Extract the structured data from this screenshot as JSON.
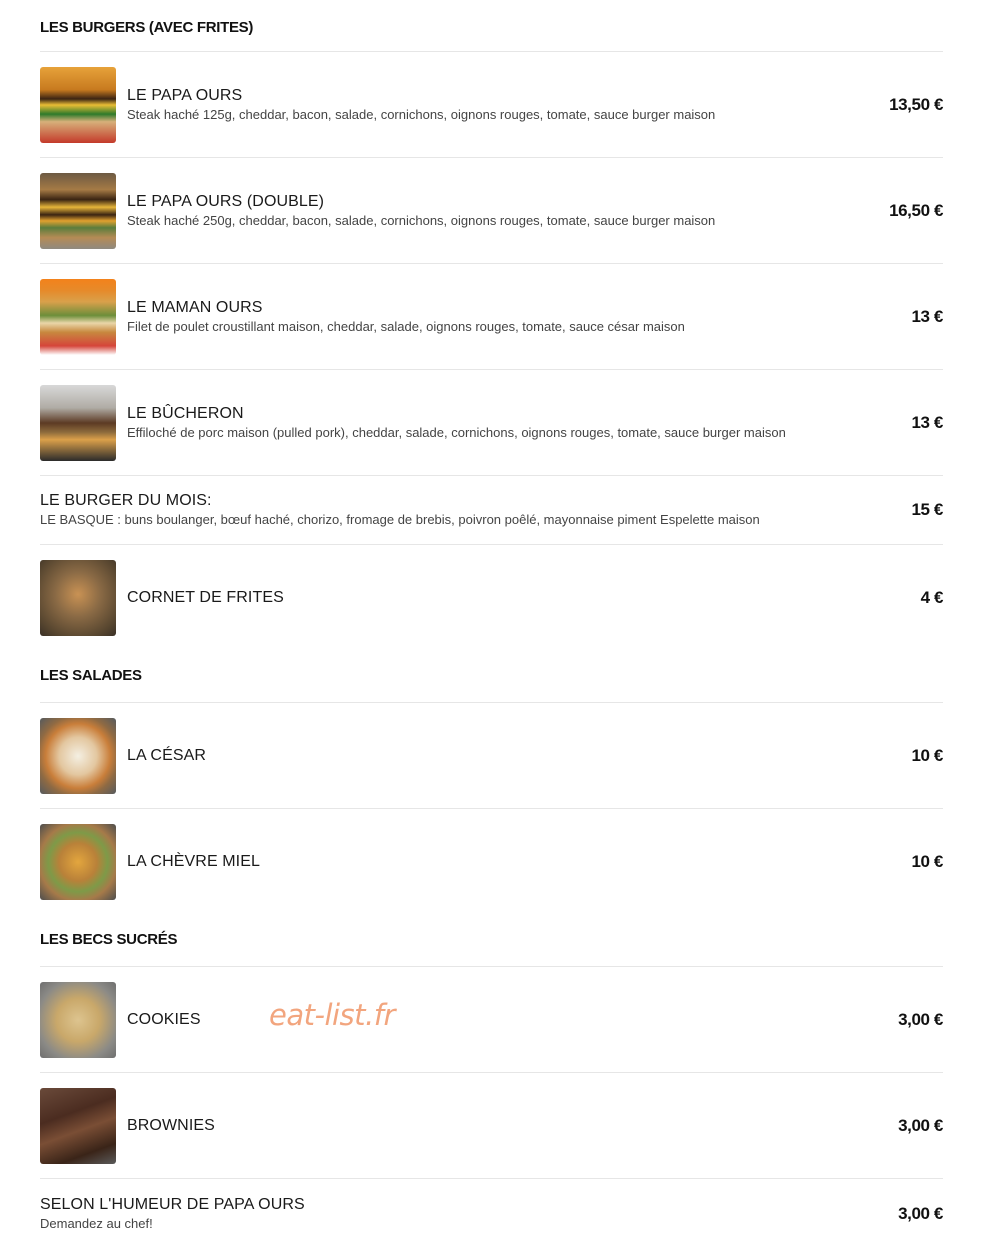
{
  "sections": {
    "burgers": {
      "title": "LES BURGERS (AVEC FRITES)",
      "items": [
        {
          "name": "LE PAPA OURS",
          "desc": "Steak haché 125g, cheddar, bacon, salade, cornichons, oignons rouges, tomate, sauce burger maison",
          "price": "13,50 €"
        },
        {
          "name": "LE PAPA OURS (DOUBLE)",
          "desc": "Steak haché 250g, cheddar, bacon, salade, cornichons, oignons rouges, tomate, sauce burger maison",
          "price": "16,50 €"
        },
        {
          "name": "LE MAMAN OURS",
          "desc": "Filet de poulet croustillant maison, cheddar, salade, oignons rouges, tomate, sauce césar maison",
          "price": "13 €"
        },
        {
          "name": "LE BÛCHERON",
          "desc": "Effiloché de porc maison (pulled pork), cheddar, salade, cornichons, oignons rouges, tomate, sauce burger maison",
          "price": "13 €"
        },
        {
          "name": "LE BURGER DU MOIS:",
          "desc": "LE BASQUE : buns boulanger, bœuf haché, chorizo, fromage de brebis, poivron poêlé, mayonnaise piment Espelette maison",
          "price": "15 €"
        },
        {
          "name": "CORNET DE FRITES",
          "desc": "",
          "price": "4 €"
        }
      ]
    },
    "salades": {
      "title": "LES SALADES",
      "items": [
        {
          "name": "LA CÉSAR",
          "price": "10 €"
        },
        {
          "name": "LA CHÈVRE MIEL",
          "price": "10 €"
        }
      ]
    },
    "sucres": {
      "title": "LES BECS SUCRÉS",
      "items": [
        {
          "name": "COOKIES",
          "price": "3,00 €"
        },
        {
          "name": "BROWNIES",
          "price": "3,00 €"
        },
        {
          "name": "SELON L'HUMEUR DE PAPA OURS",
          "desc": "Demandez au chef!",
          "price": "3,00 €"
        }
      ]
    }
  },
  "watermark": "eat-list.fr"
}
